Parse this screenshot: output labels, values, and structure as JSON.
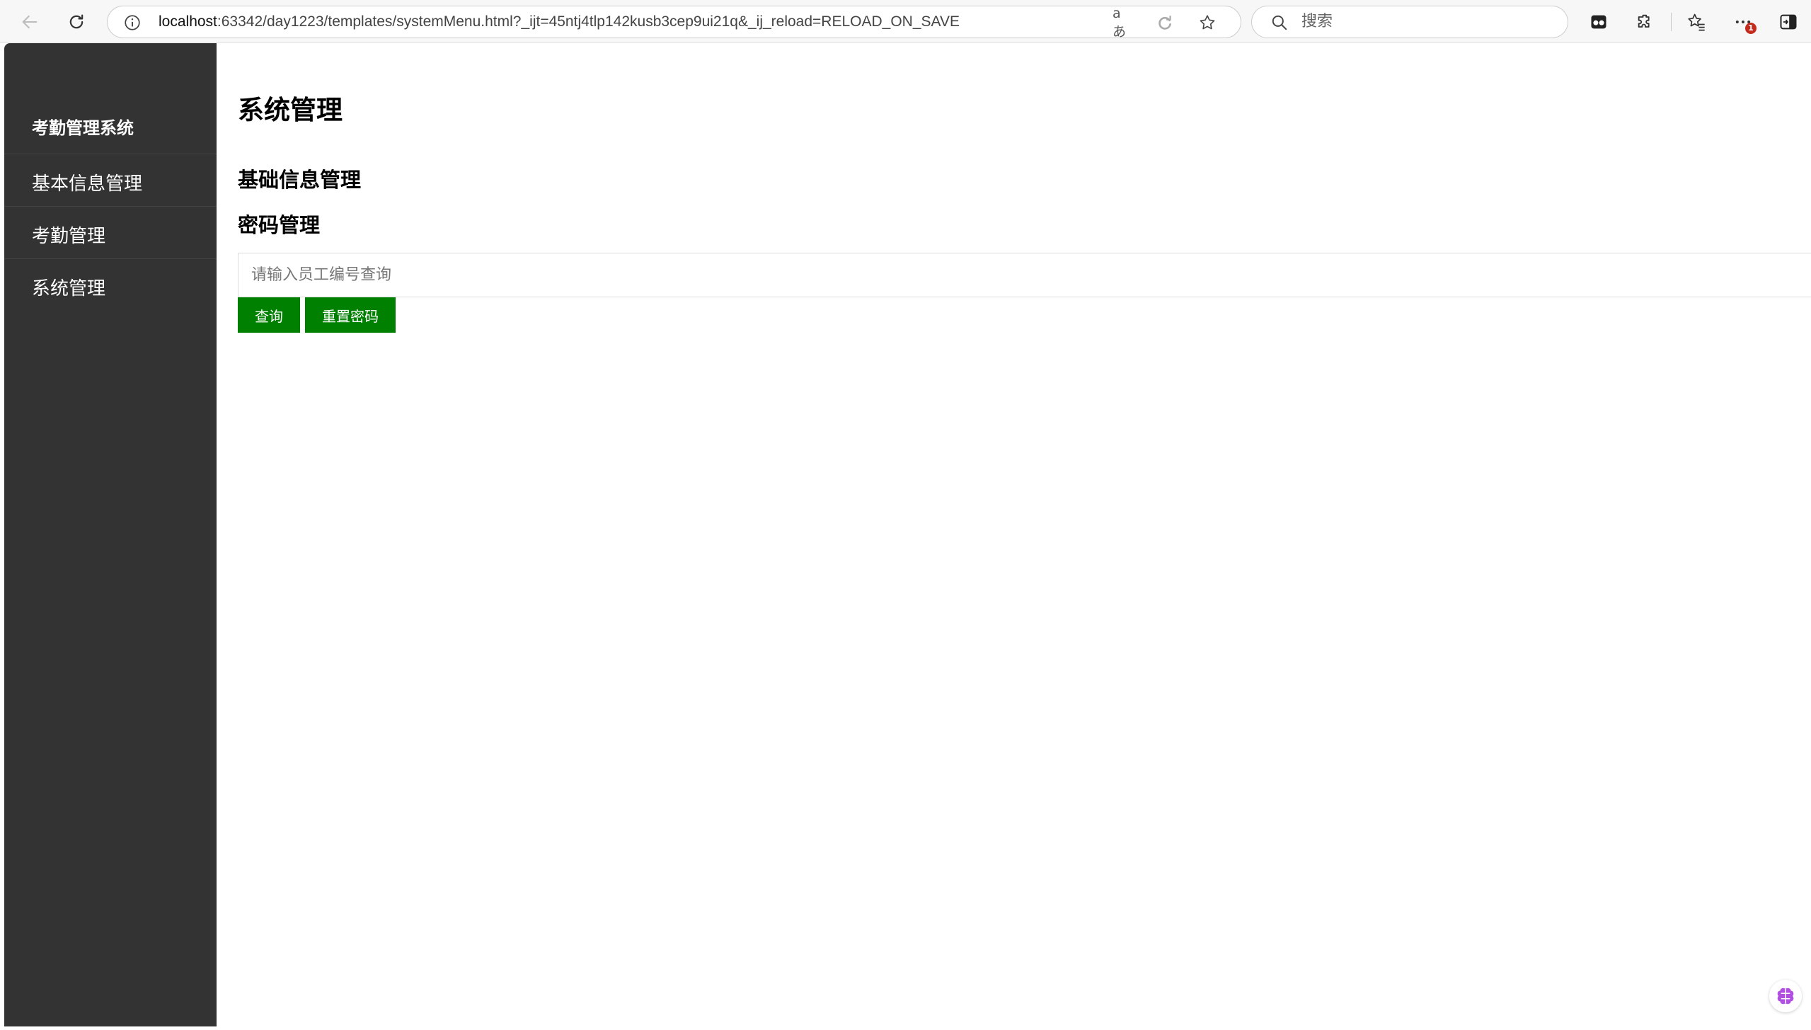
{
  "browser": {
    "url_host": "localhost",
    "url_rest": ":63342/day1223/templates/systemMenu.html?_ijt=45ntj4tlp142kusb3cep9ui21q&_ij_reload=RELOAD_ON_SAVE",
    "search_placeholder": "搜索",
    "read_aloud_label": "aあ",
    "icons": [
      "back-icon",
      "refresh-icon",
      "info-icon",
      "read-aloud-icon",
      "edge-refresh-icon",
      "favorite-star-icon",
      "search-icon",
      "collections-icon",
      "extensions-icon",
      "favorites-icon",
      "more-icon",
      "sidebar-toggle-icon"
    ],
    "notification_count": "1"
  },
  "sidebar": {
    "title": "考勤管理系统",
    "items": [
      {
        "label": "基本信息管理"
      },
      {
        "label": "考勤管理"
      },
      {
        "label": "系统管理"
      }
    ],
    "background": "#333333"
  },
  "main": {
    "page_title": "系统管理",
    "sections": [
      {
        "label": "基础信息管理"
      },
      {
        "label": "密码管理"
      }
    ],
    "search": {
      "placeholder": "请输入员工编号查询",
      "value": ""
    },
    "buttons": {
      "query_label": "查询",
      "reset_password_label": "重置密码"
    },
    "button_color": "#008000"
  }
}
